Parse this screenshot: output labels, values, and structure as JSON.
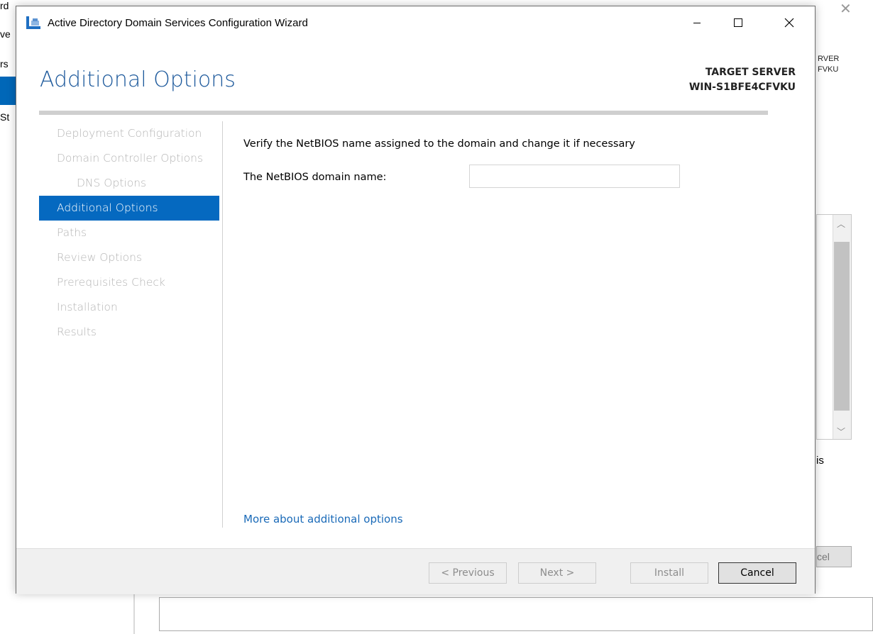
{
  "background": {
    "fragments": [
      "rd",
      "ve",
      "rs",
      "St"
    ],
    "target_fragment_1": "RVER",
    "target_fragment_2": "FVKU",
    "is_fragment": "is",
    "cancel_fragment": "cel"
  },
  "window": {
    "title": "Active Directory Domain Services Configuration Wizard",
    "page_title": "Additional Options",
    "target_label": "TARGET SERVER",
    "target_name": "WIN-S1BFE4CFVKU"
  },
  "nav": {
    "items": [
      {
        "label": "Deployment Configuration"
      },
      {
        "label": "Domain Controller Options"
      },
      {
        "label": "DNS Options"
      },
      {
        "label": "Additional Options"
      },
      {
        "label": "Paths"
      },
      {
        "label": "Review Options"
      },
      {
        "label": "Prerequisites Check"
      },
      {
        "label": "Installation"
      },
      {
        "label": "Results"
      }
    ],
    "active": "Additional Options"
  },
  "content": {
    "heading": "Verify the NetBIOS name assigned to the domain and change it if necessary",
    "netbios_label": "The NetBIOS domain name:",
    "netbios_value": "",
    "more_link": "More about additional options"
  },
  "footer": {
    "previous": "< Previous",
    "next": "Next >",
    "install": "Install",
    "cancel": "Cancel"
  },
  "colors": {
    "accent": "#0569c0",
    "title": "#1e5a9c",
    "link": "#1a6ab8",
    "disabled_text": "#b5b5b5"
  }
}
